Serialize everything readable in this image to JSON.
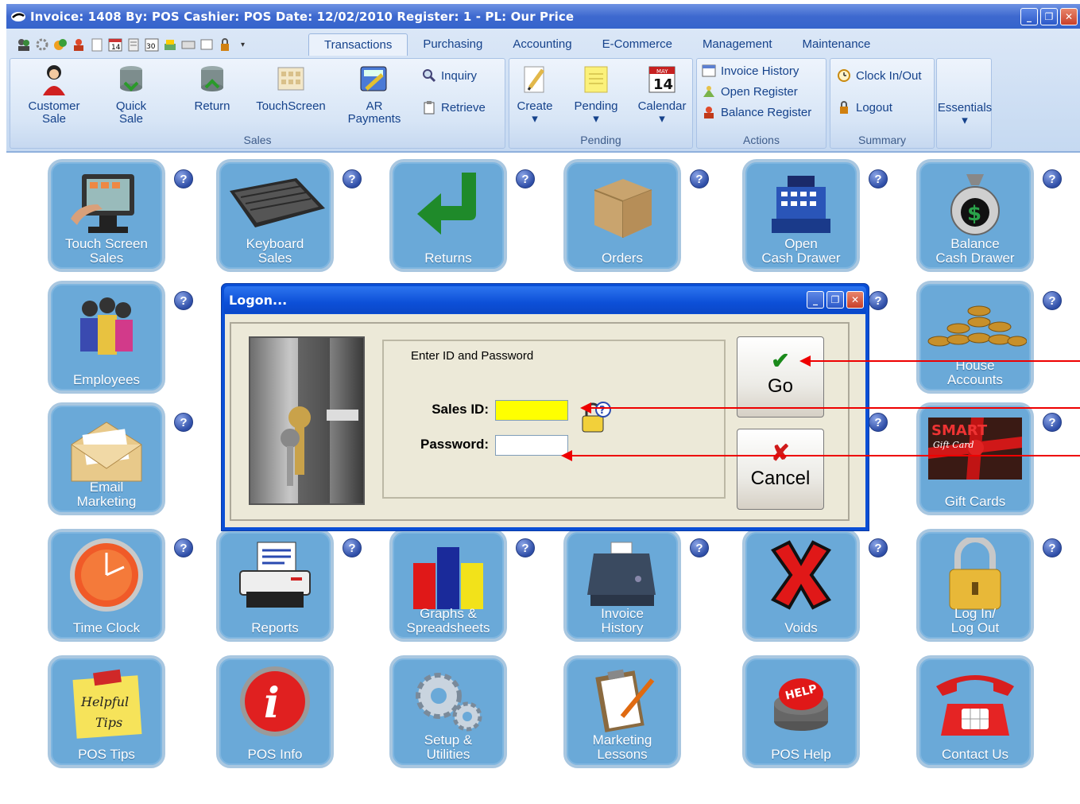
{
  "window": {
    "title": "Invoice: 1408  By: POS  Cashier: POS   Date: 12/02/2010  Register: 1  - PL: Our Price",
    "minimize": "_",
    "restore": "❐",
    "close": "✕"
  },
  "ribbon": {
    "tabs": [
      "Transactions",
      "Purchasing",
      "Accounting",
      "E-Commerce",
      "Management",
      "Maintenance"
    ],
    "active_tab": "Transactions",
    "groups": {
      "sales": {
        "label": "Sales",
        "buttons": [
          "Customer Sale",
          "Quick Sale",
          "Return",
          "TouchScreen"
        ],
        "customer_sale_line1": "Customer",
        "customer_sale_line2": "Sale",
        "quick_sale_line1": "Quick",
        "quick_sale_line2": "Sale"
      },
      "ar": {
        "line1": "AR",
        "line2": "Payments",
        "inquiry": "Inquiry",
        "retrieve": "Retrieve"
      },
      "pending": {
        "label": "Pending",
        "create": "Create",
        "pending": "Pending",
        "calendar": "Calendar",
        "calendar_day": "14",
        "calendar_month": "MAY"
      },
      "actions": {
        "label": "Actions",
        "invoice_history": "Invoice History",
        "open_register": "Open Register",
        "balance_register": "Balance Register"
      },
      "summary": {
        "label": "Summary",
        "clock": "Clock In/Out",
        "logout": "Logout"
      },
      "essentials": "Essentials"
    }
  },
  "tiles": {
    "touch_screen_sales": [
      "Touch Screen",
      "Sales"
    ],
    "keyboard_sales": [
      "Keyboard",
      "Sales"
    ],
    "returns": [
      "Returns"
    ],
    "orders": [
      "Orders"
    ],
    "open_cash_drawer": [
      "Open",
      "Cash Drawer"
    ],
    "balance_cash_drawer": [
      "Balance",
      "Cash Drawer"
    ],
    "employees": [
      "Employees"
    ],
    "house_accounts": [
      "House",
      "Accounts"
    ],
    "email_marketing": [
      "Email",
      "Marketing"
    ],
    "gift_cards": [
      "Gift Cards"
    ],
    "gift_card_brand": "SMART",
    "gift_card_sub": "Gift Card",
    "time_clock": [
      "Time Clock"
    ],
    "reports": [
      "Reports"
    ],
    "graphs": [
      "Graphs &",
      "Spreadsheets"
    ],
    "invoice_history": [
      "Invoice",
      "History"
    ],
    "voids": [
      "Voids"
    ],
    "login_logout": [
      "Log In/",
      "Log Out"
    ],
    "pos_tips": [
      "POS Tips"
    ],
    "pos_tips_note1": "Helpful",
    "pos_tips_note2": "Tips",
    "pos_info": [
      "POS Info"
    ],
    "setup_utilities": [
      "Setup &",
      "Utilities"
    ],
    "marketing_lessons": [
      "Marketing",
      "Lessons"
    ],
    "pos_help": [
      "POS Help"
    ],
    "pos_help_badge": "HELP",
    "contact_us": [
      "Contact Us"
    ]
  },
  "help_glyph": "?",
  "logon_dialog": {
    "title": "Logon...",
    "instructions": "Enter ID and Password",
    "sales_id_label": "Sales ID:",
    "sales_id_value": "",
    "password_label": "Password:",
    "password_value": "",
    "go_label": "Go",
    "cancel_label": "Cancel",
    "go_glyph": "✔",
    "cancel_glyph": "✘"
  },
  "colors": {
    "titlebar": "#3564cc",
    "tile": "#6aa9d8",
    "sales_id_field": "#ffff00",
    "annotation_arrow": "#e00000"
  }
}
